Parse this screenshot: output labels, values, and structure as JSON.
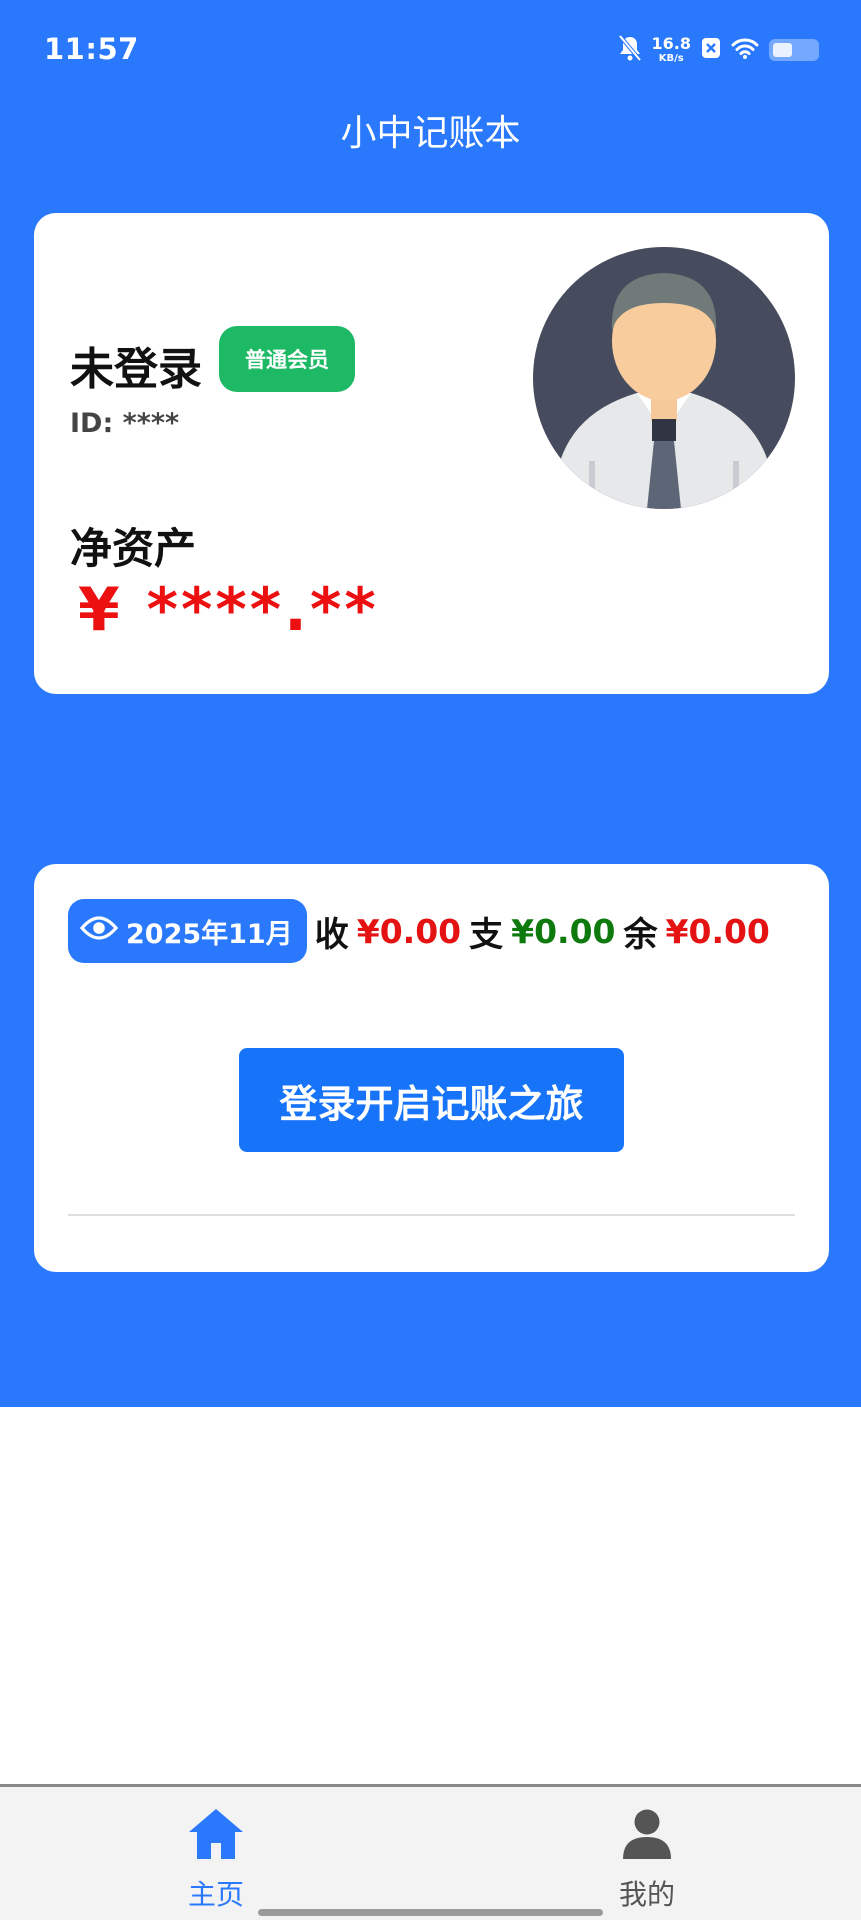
{
  "status_bar": {
    "time": "11:57",
    "net_speed_value": "16.8",
    "net_speed_unit": "KB/s",
    "icons": [
      "bell-off-icon",
      "close-box-icon",
      "wifi-icon",
      "battery-icon"
    ],
    "battery_level": 0.45
  },
  "app": {
    "title": "小中记账本"
  },
  "profile": {
    "name": "未登录",
    "member_badge": "普通会员",
    "id_text": "ID: ****",
    "net_assets_label": "净资产",
    "net_assets_value": "¥ ****.**",
    "avatar_icon": "user-avatar"
  },
  "summary": {
    "month": "2025年11月",
    "eye_icon": "eye-icon",
    "income_label": "收",
    "income_value": "¥0.00",
    "expense_label": "支",
    "expense_value": "¥0.00",
    "balance_label": "余",
    "balance_value": "¥0.00"
  },
  "login_button": "登录开启记账之旅",
  "nav": {
    "home": {
      "label": "主页",
      "icon": "home-icon"
    },
    "mine": {
      "label": "我的",
      "icon": "person-icon"
    }
  },
  "colors": {
    "primary_blue": "#2a79fd",
    "button_blue": "#1774f8",
    "badge_green": "#1db965",
    "income_red": "#e41212",
    "expense_green": "#0e7a0e"
  }
}
